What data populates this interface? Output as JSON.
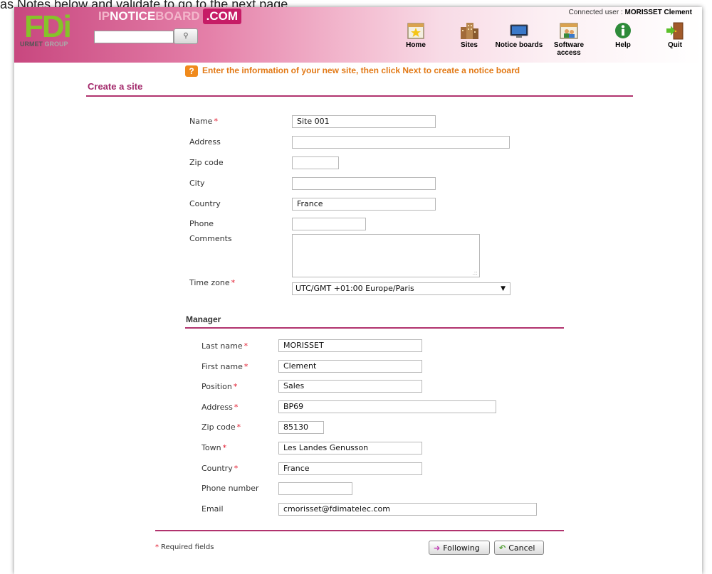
{
  "page_header_text": "as Notes below and validate to go to the next page.",
  "brand": {
    "fdi": "FDi",
    "group_a": "URMET",
    "group_b": "GROUP",
    "ip": "IP",
    "notice": "NOTICE",
    "board": "BOARD",
    "com": ".COM"
  },
  "user": {
    "connected_label": "Connected user :",
    "name": "MORISSET Clement"
  },
  "nav": {
    "home": "Home",
    "sites": "Sites",
    "notice_boards": "Notice boards",
    "software_line1": "Software",
    "software_line2": "access",
    "help": "Help",
    "quit": "Quit"
  },
  "info_message": "Enter the information of your new site, then click Next to create a notice board",
  "section_title": "Create a site",
  "site_form": {
    "name_label": "Name",
    "name_value": "Site 001",
    "address_label": "Address",
    "address_value": "",
    "zip_label": "Zip code",
    "zip_value": "",
    "city_label": "City",
    "city_value": "",
    "country_label": "Country",
    "country_value": "France",
    "phone_label": "Phone",
    "phone_value": "",
    "comments_label": "Comments",
    "comments_value": "",
    "timezone_label": "Time zone",
    "timezone_value": "UTC/GMT +01:00 Europe/Paris"
  },
  "manager": {
    "title": "Manager",
    "last_name_label": "Last name",
    "last_name_value": "MORISSET",
    "first_name_label": "First name",
    "first_name_value": "Clement",
    "position_label": "Position",
    "position_value": "Sales",
    "address_label": "Address",
    "address_value": "BP69",
    "zip_label": "Zip code",
    "zip_value": "85130",
    "town_label": "Town",
    "town_value": "Les Landes Genusson",
    "country_label": "Country",
    "country_value": "France",
    "phone_label": "Phone number",
    "phone_value": "",
    "email_label": "Email",
    "email_value": "cmorisset@fdimatelec.com"
  },
  "required_star": "*",
  "required_note": "Required fields",
  "buttons": {
    "following": "Following",
    "cancel": "Cancel"
  },
  "colors": {
    "accent": "#b1336e",
    "brand_green": "#86c32a",
    "info_orange": "#e27a17",
    "required_red": "#e2172b"
  }
}
